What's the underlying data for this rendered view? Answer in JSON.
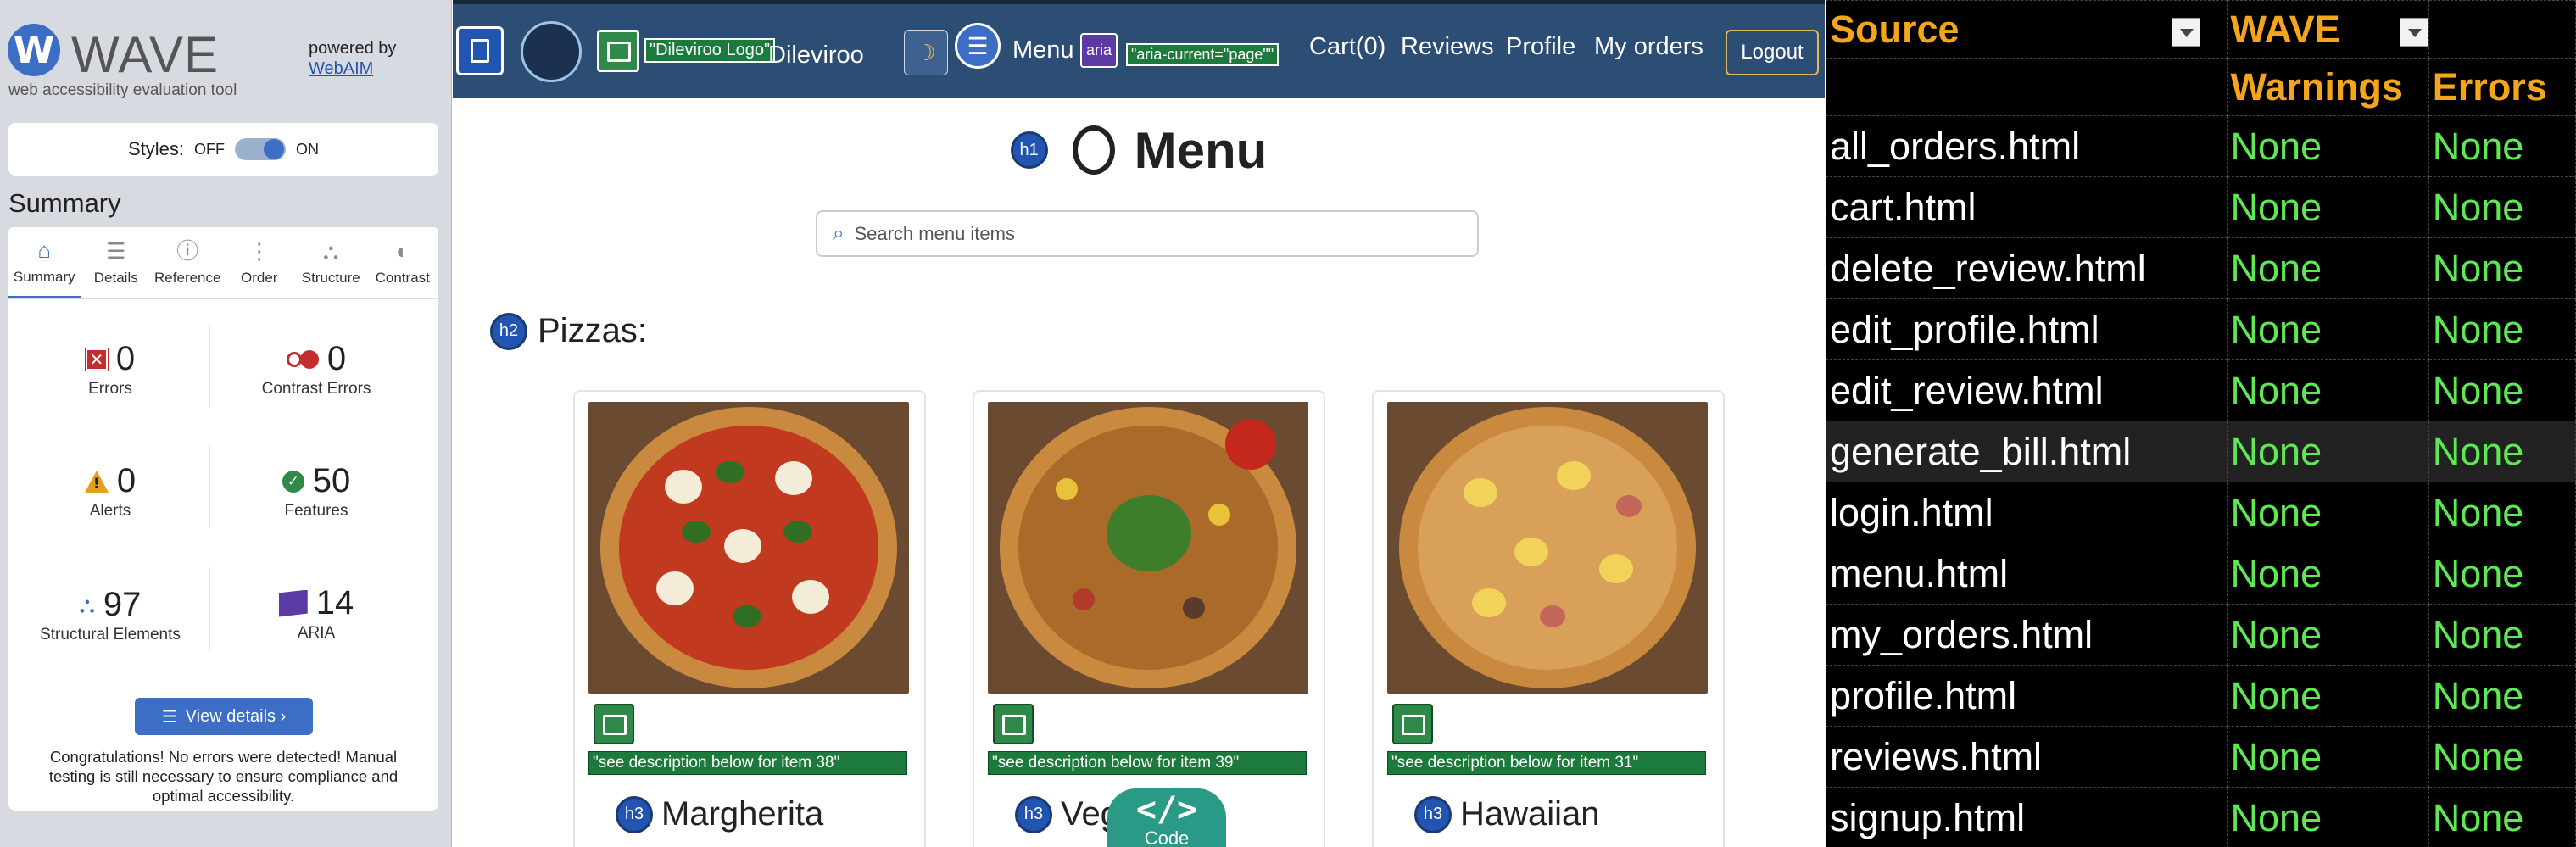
{
  "wave": {
    "logo_letter": "W",
    "logo_text": "WAVE",
    "subtitle": "web accessibility evaluation tool",
    "powered_by": "powered by",
    "webaim": "WebAIM",
    "styles_label": "Styles:",
    "styles_off": "OFF",
    "styles_on": "ON",
    "summary_title": "Summary",
    "tabs": [
      {
        "label": "Summary",
        "icon": "home-icon",
        "glyph": "⌂"
      },
      {
        "label": "Details",
        "icon": "list-icon",
        "glyph": "☰"
      },
      {
        "label": "Reference",
        "icon": "info-icon",
        "glyph": "ⓘ"
      },
      {
        "label": "Order",
        "icon": "order-icon",
        "glyph": "⋮"
      },
      {
        "label": "Structure",
        "icon": "structure-icon",
        "glyph": "⛬"
      },
      {
        "label": "Contrast",
        "icon": "contrast-icon",
        "glyph": "◐"
      }
    ],
    "stats": {
      "errors": {
        "value": "0",
        "label": "Errors"
      },
      "contrast": {
        "value": "0",
        "label": "Contrast Errors"
      },
      "alerts": {
        "value": "0",
        "label": "Alerts"
      },
      "features": {
        "value": "50",
        "label": "Features"
      },
      "structure": {
        "value": "97",
        "label": "Structural Elements"
      },
      "aria": {
        "value": "14",
        "label": "ARIA"
      }
    },
    "view_details": "View details ›",
    "congrats": "Congratulations! No errors were detected! Manual testing is still necessary to ensure compliance and optimal accessibility."
  },
  "nav": {
    "logo_alt": "\"Dileviroo Logo\"",
    "brand": "Dileviroo",
    "menu": "Menu",
    "aria_badge": "aria",
    "aria_current": "\"aria-current=\"page\"\"",
    "cart": "Cart(0)",
    "reviews": "Reviews",
    "profile": "Profile",
    "my_orders": "My orders",
    "logout": "Logout",
    "moon_glyph": "☽"
  },
  "page": {
    "h1_badge": "h1",
    "title": "Menu",
    "search_placeholder": "Search menu items",
    "h2_badge": "h2",
    "section": "Pizzas:",
    "h3_badge": "h3",
    "cards": [
      {
        "desc": "\"see description below for item 38\"",
        "name": "Margherita"
      },
      {
        "desc": "\"see description below for item 39\"",
        "name": "Veg"
      },
      {
        "desc": "\"see description below for item 31\"",
        "name": "Hawaiian"
      }
    ],
    "code_icon": "</>",
    "code_label": "Code"
  },
  "sheet": {
    "headers": {
      "source": "Source",
      "wave": "WAVE",
      "warnings": "Warnings",
      "errors": "Errors"
    },
    "rows": [
      {
        "file": "all_orders.html",
        "warnings": "None",
        "errors": "None"
      },
      {
        "file": "cart.html",
        "warnings": "None",
        "errors": "None"
      },
      {
        "file": "delete_review.html",
        "warnings": "None",
        "errors": "None"
      },
      {
        "file": "edit_profile.html",
        "warnings": "None",
        "errors": "None"
      },
      {
        "file": "edit_review.html",
        "warnings": "None",
        "errors": "None"
      },
      {
        "file": "generate_bill.html",
        "warnings": "None",
        "errors": "None"
      },
      {
        "file": "login.html",
        "warnings": "None",
        "errors": "None"
      },
      {
        "file": "menu.html",
        "warnings": "None",
        "errors": "None"
      },
      {
        "file": "my_orders.html",
        "warnings": "None",
        "errors": "None"
      },
      {
        "file": "profile.html",
        "warnings": "None",
        "errors": "None"
      },
      {
        "file": "reviews.html",
        "warnings": "None",
        "errors": "None"
      },
      {
        "file": "signup.html",
        "warnings": "None",
        "errors": "None"
      }
    ]
  },
  "colors": {
    "navbar": "#2c4d74",
    "wave_blue": "#3b6ec4",
    "sheet_header": "#f4a51c",
    "sheet_value": "#5ee854"
  }
}
